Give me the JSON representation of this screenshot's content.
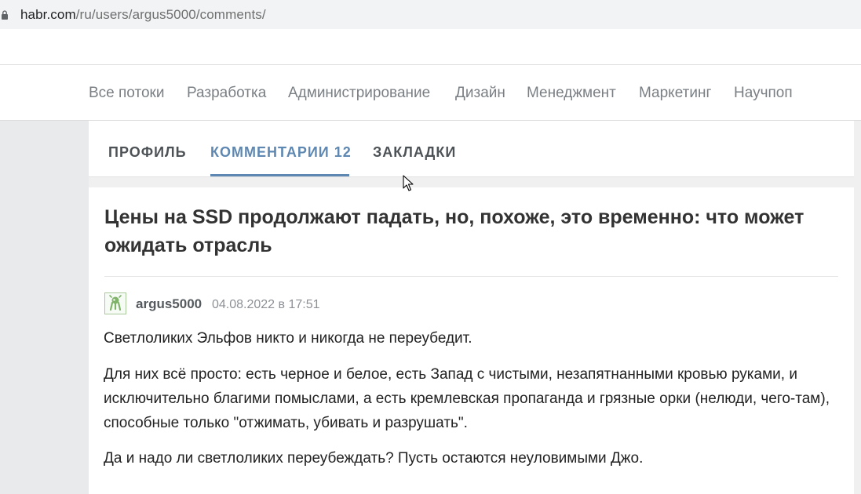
{
  "browser": {
    "url_host": "habr.com",
    "url_path": "/ru/users/argus5000/comments/"
  },
  "hubs_nav": {
    "items": [
      "Все потоки",
      "Разработка",
      "Администрирование",
      "Дизайн",
      "Менеджмент",
      "Маркетинг",
      "Научпоп"
    ]
  },
  "profile_tabs": {
    "profile": "ПРОФИЛЬ",
    "comments": "КОММЕНТАРИИ 12",
    "bookmarks": "ЗАКЛАДКИ",
    "active": "comments"
  },
  "comment": {
    "post_title": "Цены на SSD продолжают падать, но, похоже, это временно: что может ожидать отрасль",
    "author": "argus5000",
    "date": "04.08.2022 в 17:51",
    "paragraphs": [
      "Светлоликих Эльфов никто и никогда не переубедит.",
      "Для них всё просто: есть черное и белое, есть Запад с чистыми, незапятнанными кровью руками, и исключительно благими помыслами, а есть кремлевская пропаганда и грязные орки (нелюди, чего-там), способные только \"отжимать, убивать и разрушать\".",
      "Да и надо ли светлоликих переубеждать? Пусть остаются неуловимыми Джо."
    ]
  },
  "colors": {
    "accent": "#5e88b2",
    "text": "#222222",
    "muted": "#7a7f84"
  },
  "icons": {
    "address_bar": "lock-icon",
    "avatar": "robot-avatar-icon",
    "pointer": "mouse-cursor-icon"
  }
}
